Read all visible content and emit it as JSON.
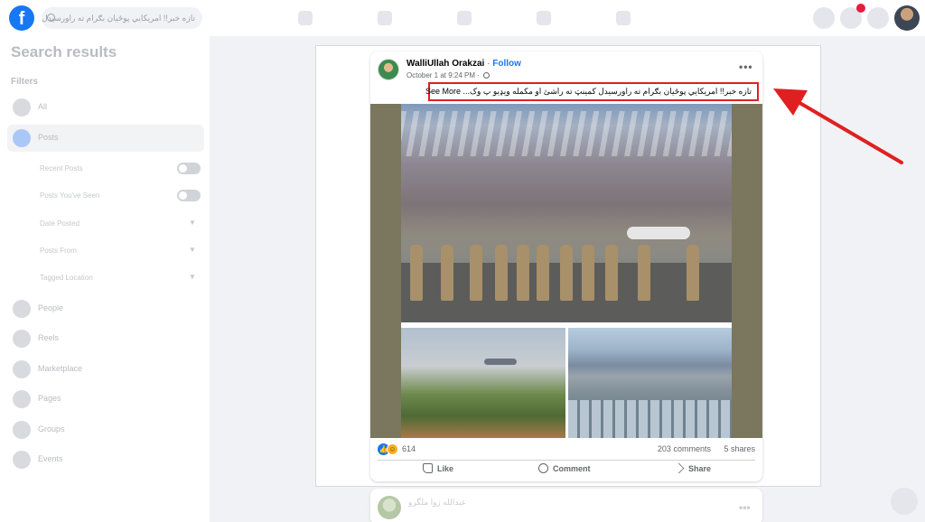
{
  "topbar": {
    "logo": "f",
    "search_placeholder": "تازه خبر!! امریکایي پوځیان بګرام ته راورسیدل"
  },
  "sidebar": {
    "title": "Search results",
    "filters_label": "Filters",
    "items": [
      {
        "label": "All",
        "icon": "all-icon"
      },
      {
        "label": "Posts",
        "icon": "posts-icon",
        "active": true
      },
      {
        "label": "People",
        "icon": "people-icon"
      },
      {
        "label": "Reels",
        "icon": "reels-icon"
      },
      {
        "label": "Marketplace",
        "icon": "marketplace-icon"
      },
      {
        "label": "Pages",
        "icon": "pages-icon"
      },
      {
        "label": "Groups",
        "icon": "groups-icon"
      },
      {
        "label": "Events",
        "icon": "events-icon"
      }
    ],
    "post_filters": [
      {
        "label": "Recent Posts",
        "control": "toggle"
      },
      {
        "label": "Posts You've Seen",
        "control": "toggle"
      },
      {
        "label": "Date Posted",
        "control": "dropdown"
      },
      {
        "label": "Posts From",
        "control": "dropdown"
      },
      {
        "label": "Tagged Location",
        "control": "dropdown"
      }
    ]
  },
  "post": {
    "author": "WalliUllah Orakzai",
    "separator": "·",
    "follow_label": "Follow",
    "timestamp": "October 1 at 9:24 PM",
    "timestamp_separator": "·",
    "more_label": "•••",
    "caption": "تازه خبر!! امریکایي پوځیان بګرام ته راورسیدل کمینټ ته راشئ او مکمله ویډیو پ وک...",
    "see_more": "See More",
    "reaction_count": "614",
    "comments": "203 comments",
    "shares": "5 shares",
    "actions": {
      "like": "Like",
      "comment": "Comment",
      "share": "Share"
    }
  },
  "next_post": {
    "author": "عبدالله زوا ملگرو"
  },
  "colors": {
    "brand": "#1877f2",
    "highlight": "#e02020",
    "page_bg": "#f0f2f5"
  }
}
